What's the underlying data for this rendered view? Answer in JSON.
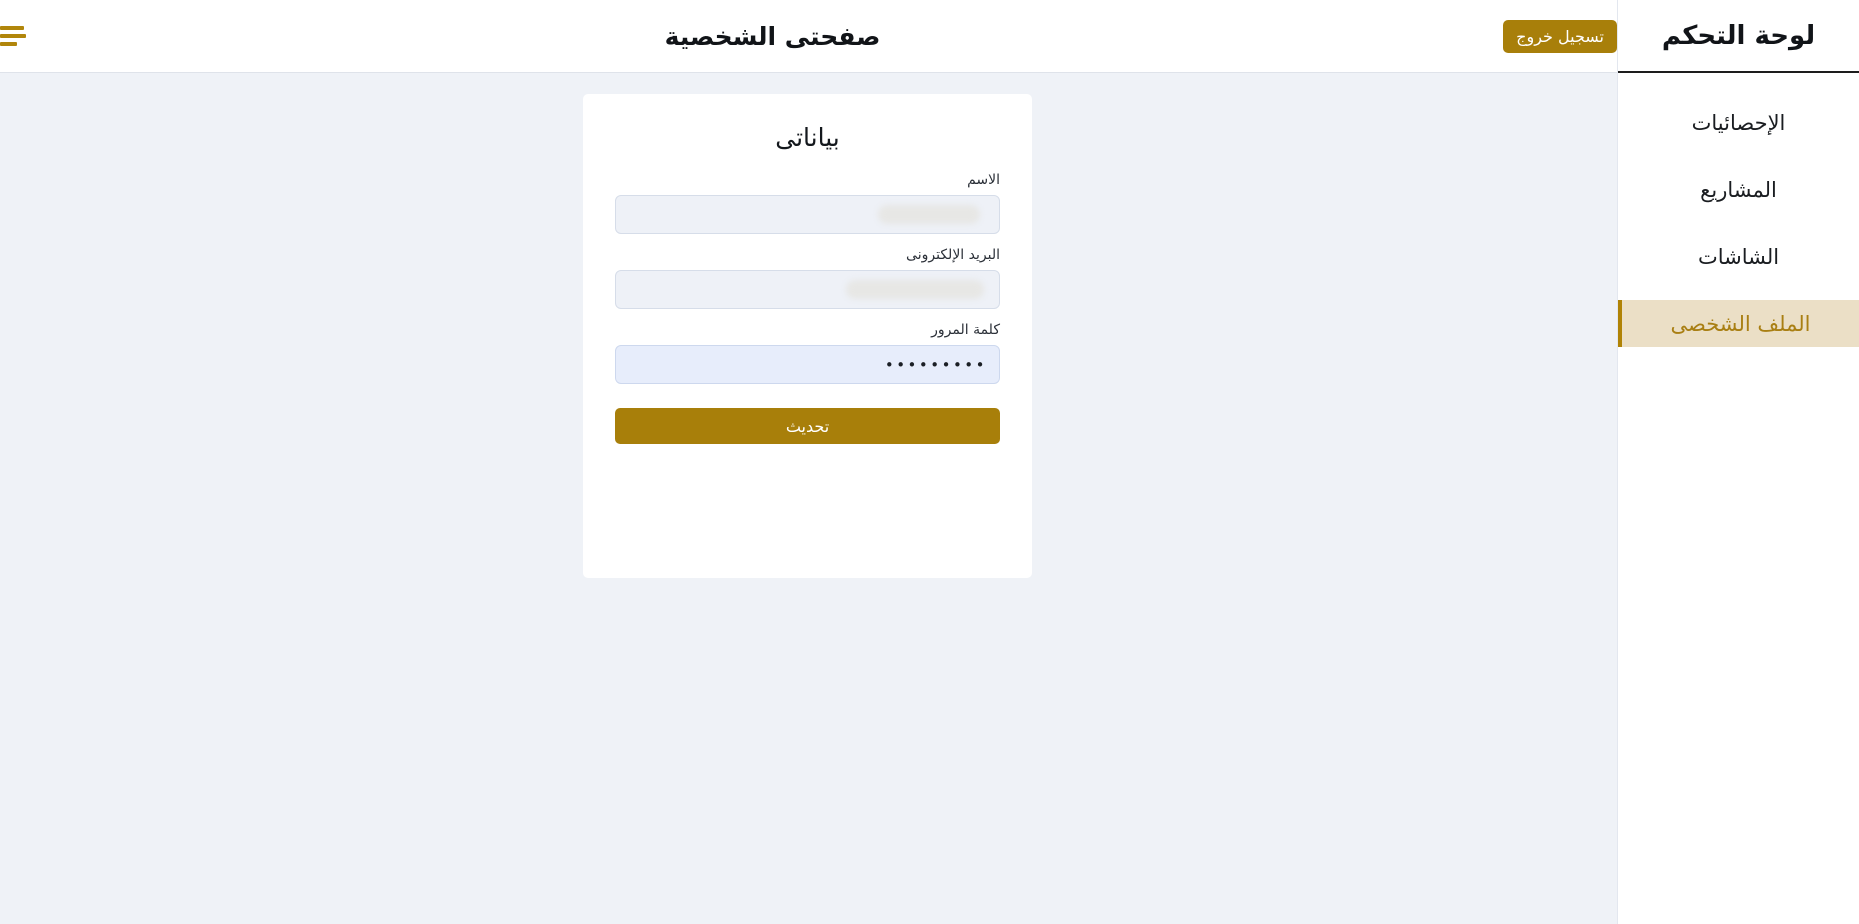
{
  "theme": {
    "accent_gold": "#a87f0a",
    "accent_gold_text": "#a97f13",
    "active_nav_bg": "#ebdfc6",
    "page_bg": "#eff2f7",
    "card_bg": "#ffffff",
    "input_bg": "#eef1f7",
    "autofill_bg": "#e7edfb"
  },
  "sidebar": {
    "title": "لوحة التحكم",
    "items": [
      {
        "label": "الإحصائيات",
        "active": false
      },
      {
        "label": "المشاريع",
        "active": false
      },
      {
        "label": "الشاشات",
        "active": false
      },
      {
        "label": "الملف الشخصى",
        "active": true
      }
    ]
  },
  "topbar": {
    "menu_icon": "hamburger-icon",
    "title": "صفحتى الشخصية",
    "logout_label": "تسجيل خروج"
  },
  "main": {
    "card": {
      "title": "بياناتى",
      "fields": [
        {
          "label": "الاسم",
          "value": "",
          "redacted": true,
          "type": "text"
        },
        {
          "label": "البريد الإلكترونى",
          "value": "",
          "redacted": true,
          "type": "email"
        },
        {
          "label": "كلمة المرور",
          "value": "•••••••••",
          "redacted": false,
          "type": "password"
        }
      ],
      "submit_label": "تحديث"
    }
  }
}
